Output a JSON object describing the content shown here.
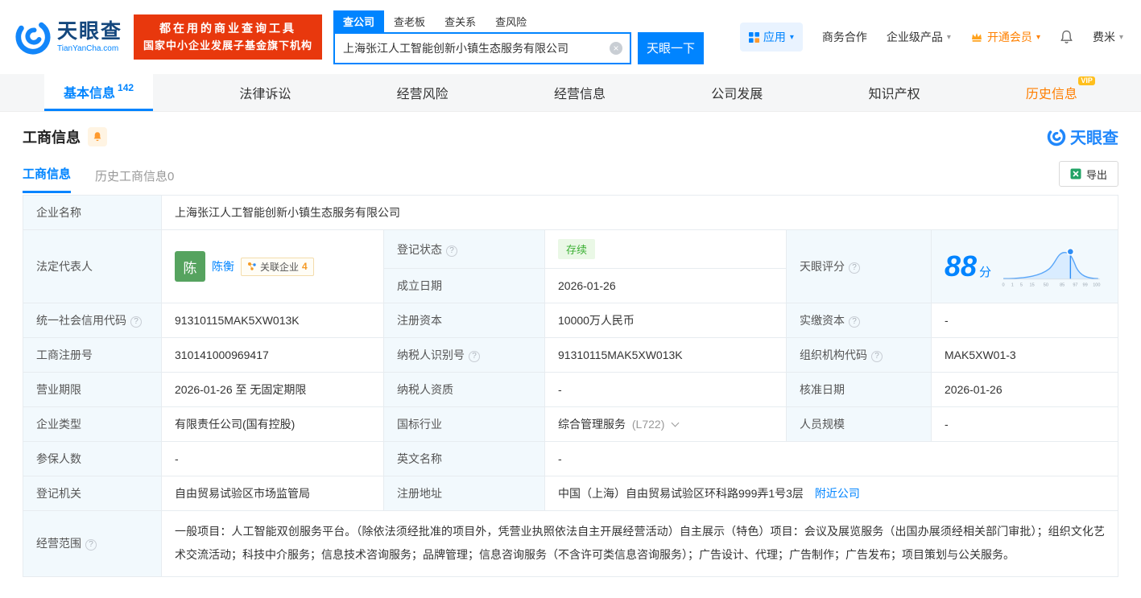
{
  "colors": {
    "primary_blue": "#0084ff",
    "promo_red": "#e8380d",
    "status_green": "#3cb034",
    "history_orange": "#ff7e00",
    "label_cell_bg": "#f2f9fd"
  },
  "icons": {
    "help": "?",
    "clear": "×",
    "caret": "▾"
  },
  "header": {
    "logo": {
      "brand": "天眼查",
      "domain": "TianYanCha.com"
    },
    "promo": {
      "line1": "都在用的商业查询工具",
      "line2": "国家中小企业发展子基金旗下机构"
    },
    "search": {
      "tabs": [
        {
          "label": "查公司"
        },
        {
          "label": "查老板"
        },
        {
          "label": "查关系"
        },
        {
          "label": "查风险"
        }
      ],
      "value": "上海张江人工智能创新小镇生态服务有限公司",
      "button": "天眼一下"
    },
    "menu": {
      "apps": "应用",
      "cooperation": "商务合作",
      "enterprise": "企业级产品",
      "vip": "开通会员",
      "username": "费米"
    }
  },
  "nav": {
    "tabs": [
      {
        "label": "基本信息",
        "count": "142"
      },
      {
        "label": "法律诉讼"
      },
      {
        "label": "经营风险"
      },
      {
        "label": "经营信息"
      },
      {
        "label": "公司发展"
      },
      {
        "label": "知识产权"
      },
      {
        "label": "历史信息",
        "vip": "VIP"
      }
    ]
  },
  "section": {
    "title": "工商信息",
    "brand": "天眼查",
    "subtabs": [
      {
        "label": "工商信息"
      },
      {
        "label": "历史工商信息",
        "count": "0"
      }
    ],
    "export": "导出"
  },
  "info": {
    "company_name": {
      "label": "企业名称",
      "value": "上海张江人工智能创新小镇生态服务有限公司"
    },
    "legal_rep": {
      "label": "法定代表人",
      "avatar": "陈",
      "name": "陈衡",
      "related_label": "关联企业",
      "related_count": "4"
    },
    "reg_status": {
      "label": "登记状态",
      "value": "存续"
    },
    "score": {
      "label": "天眼评分",
      "value": "88",
      "unit": "分",
      "axis": [
        "0",
        "1",
        "5",
        "15",
        "50",
        "85",
        "97",
        "99",
        "100"
      ]
    },
    "establish_date": {
      "label": "成立日期",
      "value": "2026-01-26"
    },
    "credit_code": {
      "label": "统一社会信用代码",
      "value": "91310115MAK5XW013K"
    },
    "reg_capital": {
      "label": "注册资本",
      "value": "10000万人民币"
    },
    "paid_capital": {
      "label": "实缴资本",
      "value": "-"
    },
    "reg_number": {
      "label": "工商注册号",
      "value": "310141000969417"
    },
    "taxpayer_id": {
      "label": "纳税人识别号",
      "value": "91310115MAK5XW013K"
    },
    "org_code": {
      "label": "组织机构代码",
      "value": "MAK5XW01-3"
    },
    "business_term": {
      "label": "营业期限",
      "value": "2026-01-26 至 无固定期限"
    },
    "taxpayer_quality": {
      "label": "纳税人资质",
      "value": "-"
    },
    "approval_date": {
      "label": "核准日期",
      "value": "2026-01-26"
    },
    "company_type": {
      "label": "企业类型",
      "value": "有限责任公司(国有控股)"
    },
    "industry": {
      "label": "国标行业",
      "value": "综合管理服务",
      "code": "(L722)"
    },
    "staff_size": {
      "label": "人员规模",
      "value": "-"
    },
    "insured_count": {
      "label": "参保人数",
      "value": "-"
    },
    "english_name": {
      "label": "英文名称",
      "value": "-"
    },
    "reg_authority": {
      "label": "登记机关",
      "value": "自由贸易试验区市场监管局"
    },
    "reg_address": {
      "label": "注册地址",
      "value": "中国（上海）自由贸易试验区环科路999弄1号3层",
      "link": "附近公司"
    },
    "business_scope": {
      "label": "经营范围",
      "value": "一般项目：人工智能双创服务平台。（除依法须经批准的项目外，凭营业执照依法自主开展经营活动）自主展示（特色）项目：会议及展览服务（出国办展须经相关部门审批）；组织文化艺术交流活动；科技中介服务；信息技术咨询服务；品牌管理；信息咨询服务（不含许可类信息咨询服务）；广告设计、代理；广告制作；广告发布；项目策划与公关服务。"
    }
  }
}
